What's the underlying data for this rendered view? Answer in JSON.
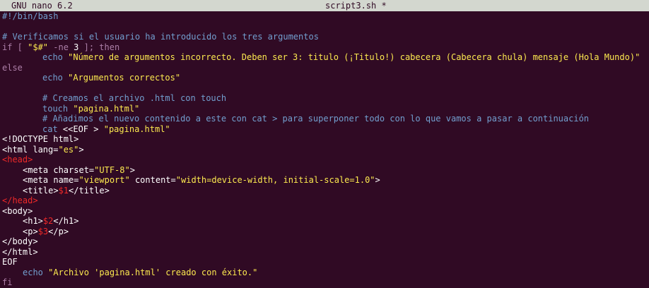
{
  "titlebar": {
    "app": "GNU nano 6.2",
    "filename": "script3.sh *"
  },
  "code": {
    "l1": "#!/bin/bash",
    "l3": "# Verificamos si el usuario ha introducido los tres argumentos",
    "l4_if": "if [ ",
    "l4_str": "\"$#\"",
    "l4_ne": " -ne ",
    "l4_num": "3",
    "l4_end": " ]; then",
    "l5_cmd": "echo",
    "l5_str": " \"Número de argumentos incorrecto. Deben ser 3: titulo (¡Titulo!) cabecera (Cabecera chula) mensaje (Hola Mundo)\"",
    "l6": "else",
    "l7_cmd": "echo",
    "l7_str": " \"Argumentos correctos\"",
    "l9": "# Creamos el archivo .html con touch",
    "l10_cmd": "touch",
    "l10_str": " \"pagina.html\"",
    "l11": "# Añadimos el nuevo contenido a este con cat > para superponer todo con lo que vamos a pasar a continuación",
    "l12_cmd": "cat",
    "l12_a": " <<EOF > ",
    "l12_str": "\"pagina.html\"",
    "l13_a": "<!DOCTYPE ",
    "l13_b": "html",
    "l13_c": ">",
    "l14_a": "<html ",
    "l14_b": "lang=",
    "l14_str": "\"es\"",
    "l14_c": ">",
    "l15": "<head>",
    "l16_a": "<meta ",
    "l16_b": "charset=",
    "l16_str": "\"UTF-8\"",
    "l16_c": ">",
    "l17_a": "<meta ",
    "l17_b": "name=",
    "l17_str1": "\"viewport\"",
    "l17_c": " content=",
    "l17_str2": "\"width=device-width, initial-scale=1.0\"",
    "l17_d": ">",
    "l18_a": "<title>",
    "l18_var": "$1",
    "l18_b": "</title>",
    "l19": "</head>",
    "l20": "<body>",
    "l21_a": "<h1>",
    "l21_var": "$2",
    "l21_b": "</h1>",
    "l22_a": "<p>",
    "l22_var": "$3",
    "l22_b": "</p>",
    "l23": "</body>",
    "l24": "</html>",
    "l25": "EOF",
    "l26_cmd": "echo",
    "l26_str": " \"Archivo 'pagina.html' creado con éxito.\"",
    "l27": "fi"
  },
  "colors": {
    "background": "#300a24",
    "titlebar": "#d3d7cf",
    "comment": "#729fcf",
    "string": "#fce94f",
    "keyword": "#ad7fa8",
    "tag": "#ef2929"
  }
}
